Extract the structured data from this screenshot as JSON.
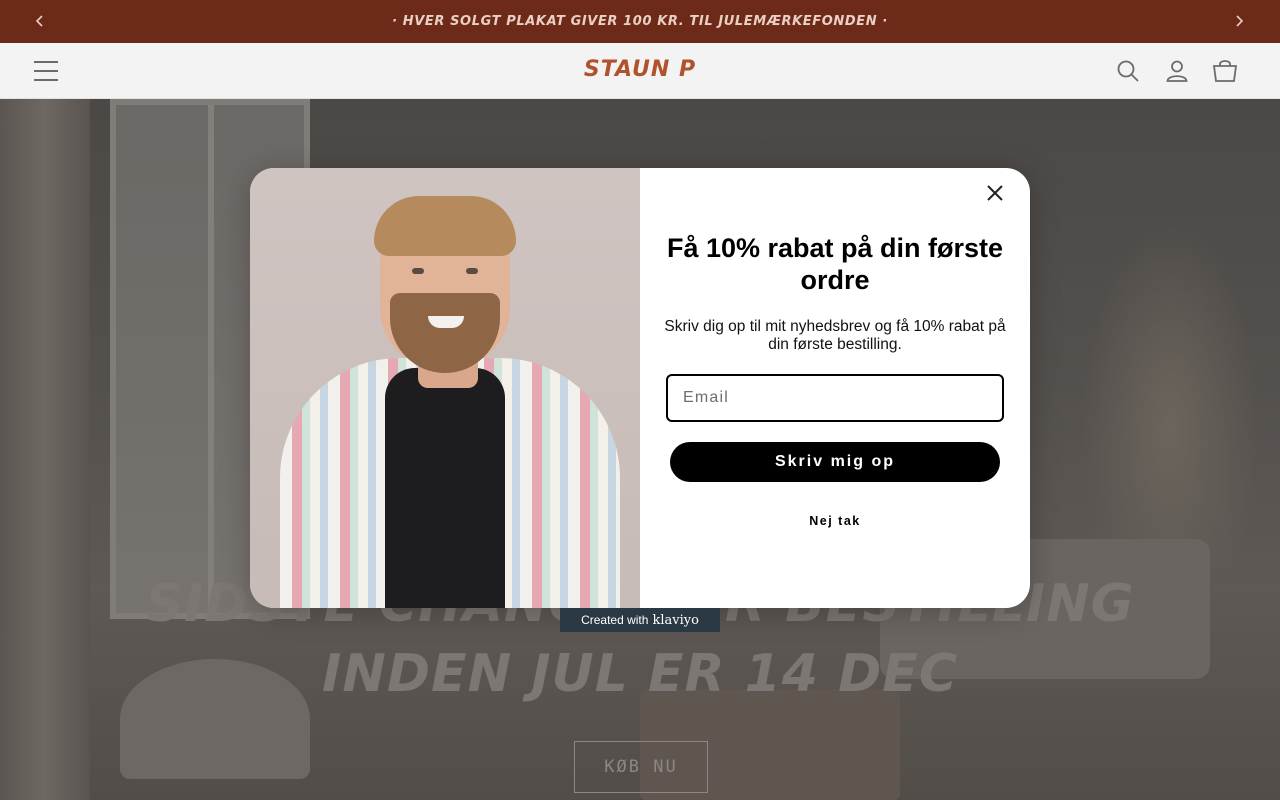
{
  "announcement": {
    "text": "· HVER SOLGT PLAKAT GIVER 100 KR. TIL JULEMÆRKEFONDEN ·",
    "prev_icon": "chevron-left-icon",
    "next_icon": "chevron-right-icon"
  },
  "header": {
    "logo": "STAUN P",
    "menu_icon": "hamburger-menu-icon",
    "search_icon": "search-icon",
    "account_icon": "user-icon",
    "cart_icon": "cart-icon"
  },
  "hero": {
    "headline": "SIDSTE CHANCE FOR BESTILLING INDEN JUL ER 14 DEC",
    "button_label": "KØB NU"
  },
  "modal": {
    "title": "Få 10% rabat på din første ordre",
    "subtitle": "Skriv dig op til mit nyhedsbrev og få 10% rabat på din første bestilling.",
    "email_placeholder": "Email",
    "email_value": "",
    "submit_label": "Skriv mig op",
    "decline_label": "Nej tak",
    "close_icon": "close-icon"
  },
  "badge": {
    "prefix": "Created with",
    "brand": "klaviyo"
  },
  "colors": {
    "announcement_bg": "#6e2a19",
    "logo": "#b0522b",
    "button_bg": "#000000"
  }
}
